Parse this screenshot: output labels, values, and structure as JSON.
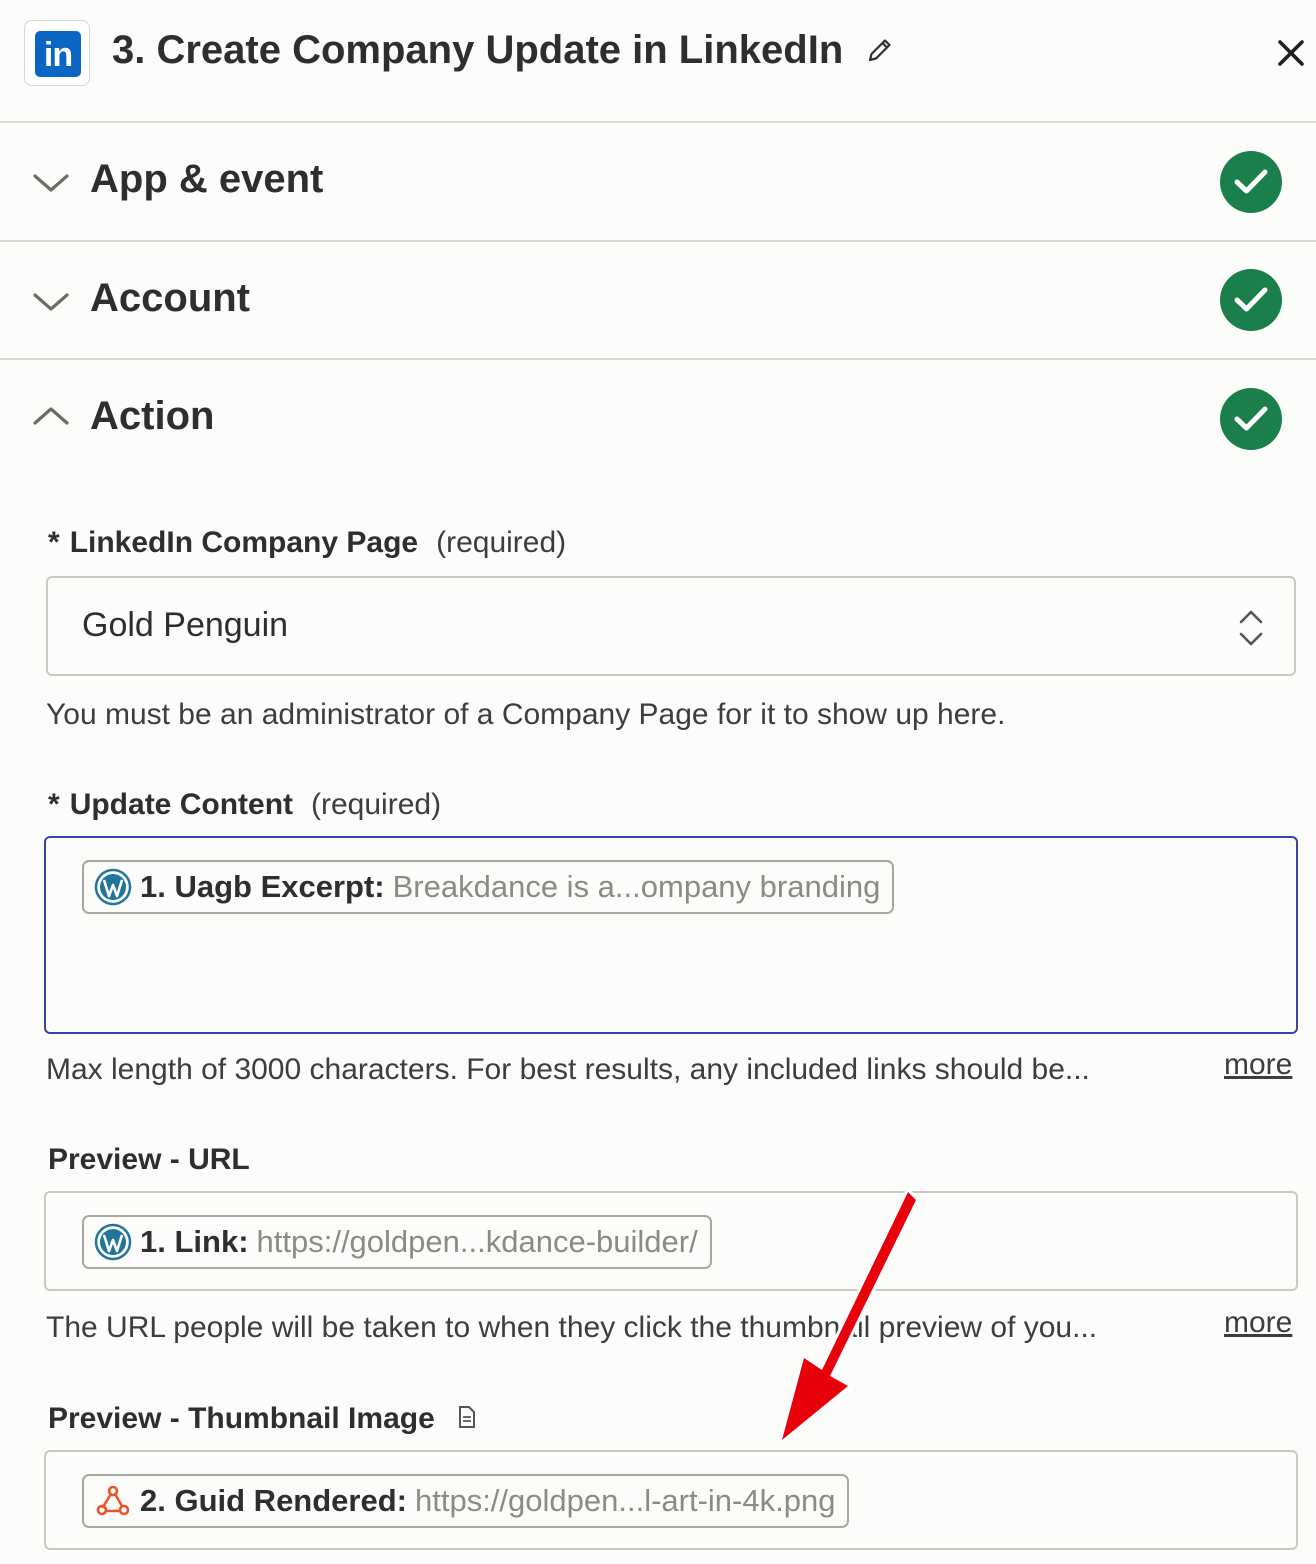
{
  "header": {
    "app_icon": "linkedin-logo",
    "app_icon_text": "in",
    "title": "3. Create Company Update in LinkedIn"
  },
  "sections": [
    {
      "label": "App & event",
      "state": "collapsed",
      "status": "complete"
    },
    {
      "label": "Account",
      "state": "collapsed",
      "status": "complete"
    },
    {
      "label": "Action",
      "state": "expanded",
      "status": "complete"
    }
  ],
  "fields": {
    "company_page": {
      "star": "*",
      "label": "LinkedIn Company Page",
      "required": "(required)",
      "value": "Gold Penguin",
      "help": "You must be an administrator of a Company Page for it to show up here."
    },
    "update_content": {
      "star": "*",
      "label": "Update Content",
      "required": "(required)",
      "pill_icon": "wordpress-icon",
      "pill_key": "1. Uagb Excerpt:",
      "pill_value": "Breakdance is a...ompany branding",
      "help": "Max length of 3000 characters. For best results, any included links should be...",
      "more": "more"
    },
    "preview_url": {
      "label": "Preview - URL",
      "pill_icon": "wordpress-icon",
      "pill_key": "1. Link:",
      "pill_value": "https://goldpen...kdance-builder/",
      "help": "The URL people will be taken to when they click the thumbnail preview of you...",
      "more": "more"
    },
    "preview_thumbnail": {
      "label": "Preview - Thumbnail Image",
      "label_icon": "document-icon",
      "pill_icon": "webhook-icon",
      "pill_key": "2. Guid Rendered:",
      "pill_value": "https://goldpen...l-art-in-4k.png"
    }
  },
  "colors": {
    "linkedin": "#0a66c2",
    "check_green": "#1b7f4c",
    "focus_border": "#3b43a6",
    "webhook_orange": "#e8562a",
    "annotation_arrow": "#e8000b"
  }
}
